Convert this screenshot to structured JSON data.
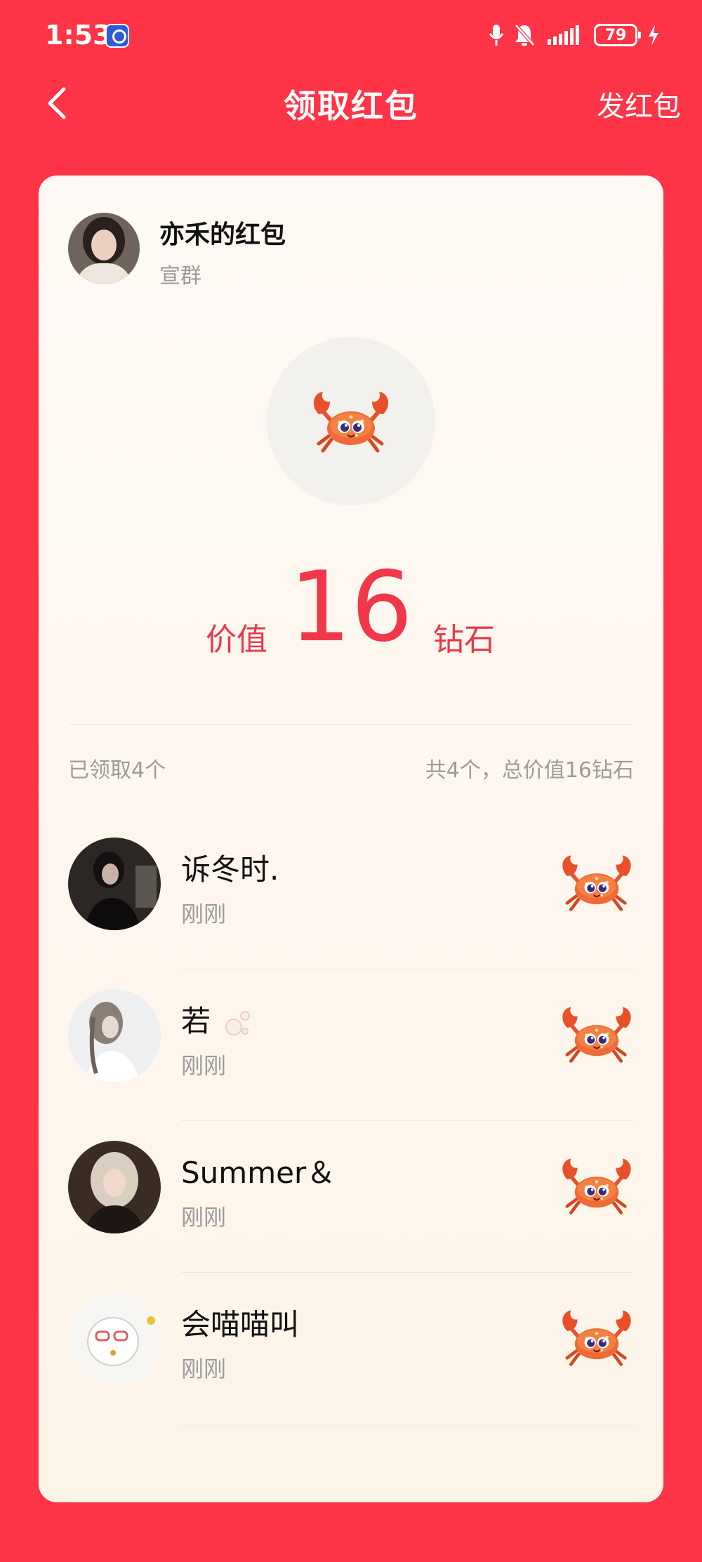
{
  "status_bar": {
    "time": "1:53",
    "battery": "79"
  },
  "nav": {
    "title": "领取红包",
    "action": "发红包"
  },
  "packet": {
    "sender_name": "亦禾的红包",
    "subtitle": "宣群",
    "value_prefix": "价值",
    "value": "16",
    "value_suffix": "钻石"
  },
  "summary": {
    "claimed": "已领取4个",
    "total": "共4个，总价值16钻石"
  },
  "claims": [
    {
      "name": "诉冬时.",
      "time": "刚刚"
    },
    {
      "name": "若",
      "time": "刚刚"
    },
    {
      "name": "Summer＆",
      "time": "刚刚"
    },
    {
      "name": "会喵喵叫",
      "time": "刚刚"
    }
  ],
  "colors": {
    "background": "#FF3446",
    "accent": "#F2374A",
    "card": "#FFF9F5"
  }
}
